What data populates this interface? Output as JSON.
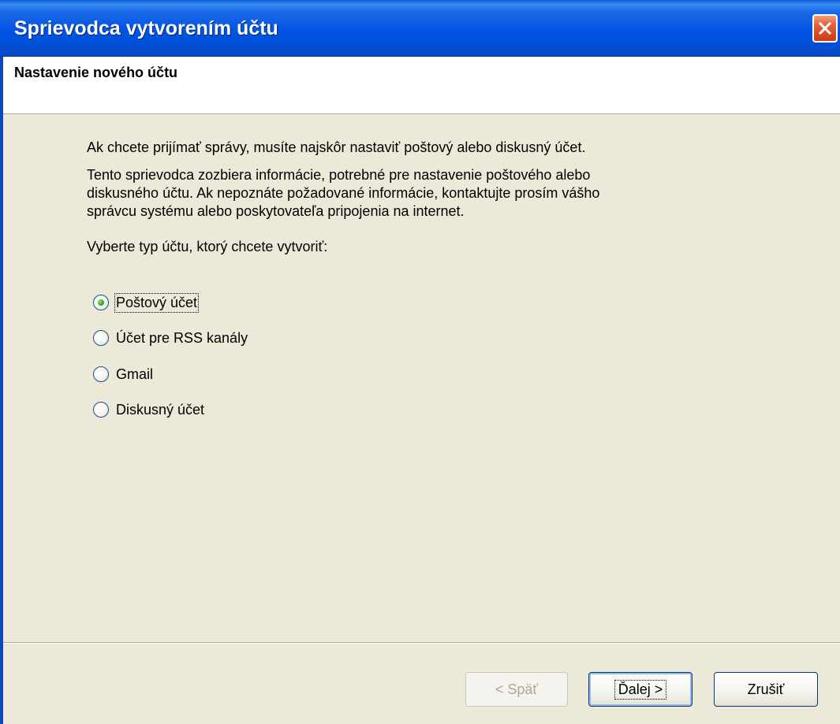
{
  "window": {
    "title": "Sprievodca vytvorením účtu",
    "header_title": "Nastavenie nového účtu"
  },
  "intro": {
    "line1": "Ak chcete prijímať správy, musíte najskôr nastaviť poštový alebo diskusný účet.",
    "para2_line1": "Tento sprievodca zozbiera informácie, potrebné pre nastavenie poštového alebo",
    "para2_line2": "diskusného účtu. Ak nepoznáte požadované informácie, kontaktujte prosím vášho",
    "para2_line3": "správcu systému alebo poskytovateľa pripojenia na internet.",
    "prompt": "Vyberte typ účtu, ktorý chcete vytvoriť:"
  },
  "account_types": [
    {
      "label": "Poštový účet",
      "checked": true
    },
    {
      "label": "Účet pre RSS kanály",
      "checked": false
    },
    {
      "label": "Gmail",
      "checked": false
    },
    {
      "label": "Diskusný účet",
      "checked": false
    }
  ],
  "buttons": {
    "back": "< Späť",
    "next": "Ďalej >",
    "cancel": "Zrušiť"
  },
  "colors": {
    "titlebar": "#0054e3",
    "dialog_bg": "#ece9d8",
    "close_button": "#e2623a",
    "radio_checked": "#2fa618"
  }
}
